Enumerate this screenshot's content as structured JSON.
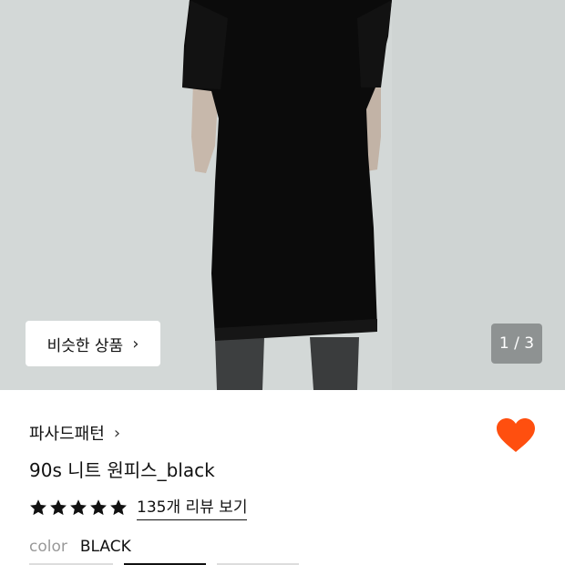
{
  "gallery": {
    "similar_label": "비슷한 상품",
    "similar_chevron": "›",
    "counter": "1 / 3"
  },
  "product": {
    "brand": "파사드패턴",
    "brand_chevron": "›",
    "title": "90s 니트 원피스_black",
    "rating": 5,
    "review_link": "135개 리뷰 보기",
    "color_label": "color",
    "color_value": "BLACK",
    "liked": true
  },
  "colors": {
    "accent_heart": "#ff4f0f",
    "star": "#111111"
  }
}
